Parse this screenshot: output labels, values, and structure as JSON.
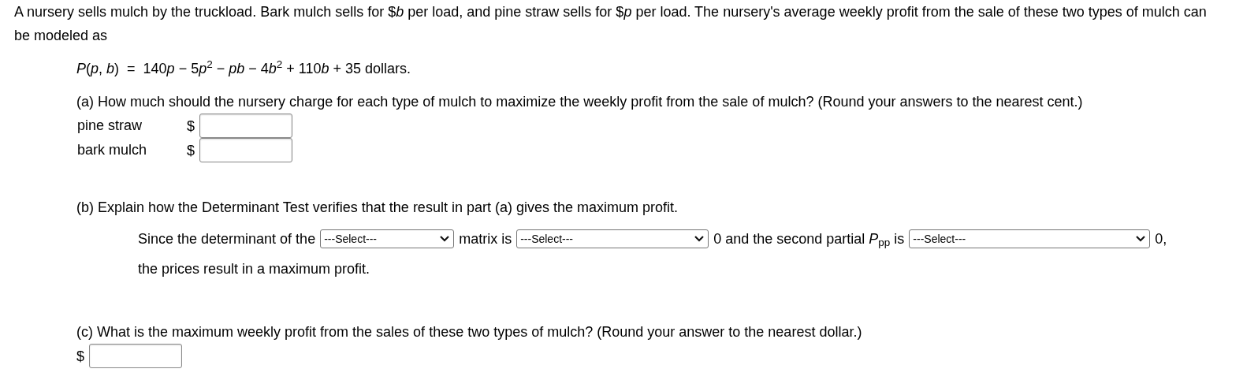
{
  "intro": "A nursery sells mulch by the truckload. Bark mulch sells for $*b* per load, and pine straw sells for $*p* per load. The nursery's average weekly profit from the sale of these two types of mulch can be modeled as",
  "formula": [
    {
      "kind": "var",
      "text": "P"
    },
    {
      "kind": "plain",
      "text": "("
    },
    {
      "kind": "var",
      "text": "p"
    },
    {
      "kind": "plain",
      "text": ", "
    },
    {
      "kind": "var",
      "text": "b"
    },
    {
      "kind": "plain",
      "text": ")  =  140"
    },
    {
      "kind": "var",
      "text": "p"
    },
    {
      "kind": "plain",
      "text": " − 5"
    },
    {
      "kind": "var",
      "text": "p"
    },
    {
      "kind": "sup",
      "text": "2"
    },
    {
      "kind": "plain",
      "text": " − "
    },
    {
      "kind": "var",
      "text": "pb"
    },
    {
      "kind": "plain",
      "text": " − 4"
    },
    {
      "kind": "var",
      "text": "b"
    },
    {
      "kind": "sup",
      "text": "2"
    },
    {
      "kind": "plain",
      "text": " + 110"
    },
    {
      "kind": "var",
      "text": "b"
    },
    {
      "kind": "plain",
      "text": " + 35 dollars."
    }
  ],
  "part_a": {
    "question": "(a) How much should the nursery charge for each type of mulch to maximize the weekly profit from the sale of mulch? (Round your answers to the nearest cent.)",
    "answers": [
      {
        "label": "pine straw",
        "prefix": "$"
      },
      {
        "label": "bark mulch",
        "prefix": "$"
      }
    ]
  },
  "part_b": {
    "question": "(b) Explain how the Determinant Test verifies that the result in part (a) gives the maximum profit.",
    "line_1": [
      {
        "kind": "text",
        "text": "Since the determinant of the"
      },
      {
        "kind": "select",
        "value": "---Select---"
      },
      {
        "kind": "text",
        "text": "matrix is"
      },
      {
        "kind": "select",
        "value": "---Select---"
      },
      {
        "kind": "text",
        "text": "0 and the second partial *P*$_{pp}$ is"
      },
      {
        "kind": "select",
        "value": "---Select---"
      },
      {
        "kind": "text",
        "text": "0,"
      }
    ],
    "line_2": "the prices result in a maximum profit."
  },
  "part_c": {
    "question": "(c) What is the maximum weekly profit from the sales of these two types of mulch? (Round your answer to the nearest dollar.)",
    "prefix": "$"
  }
}
